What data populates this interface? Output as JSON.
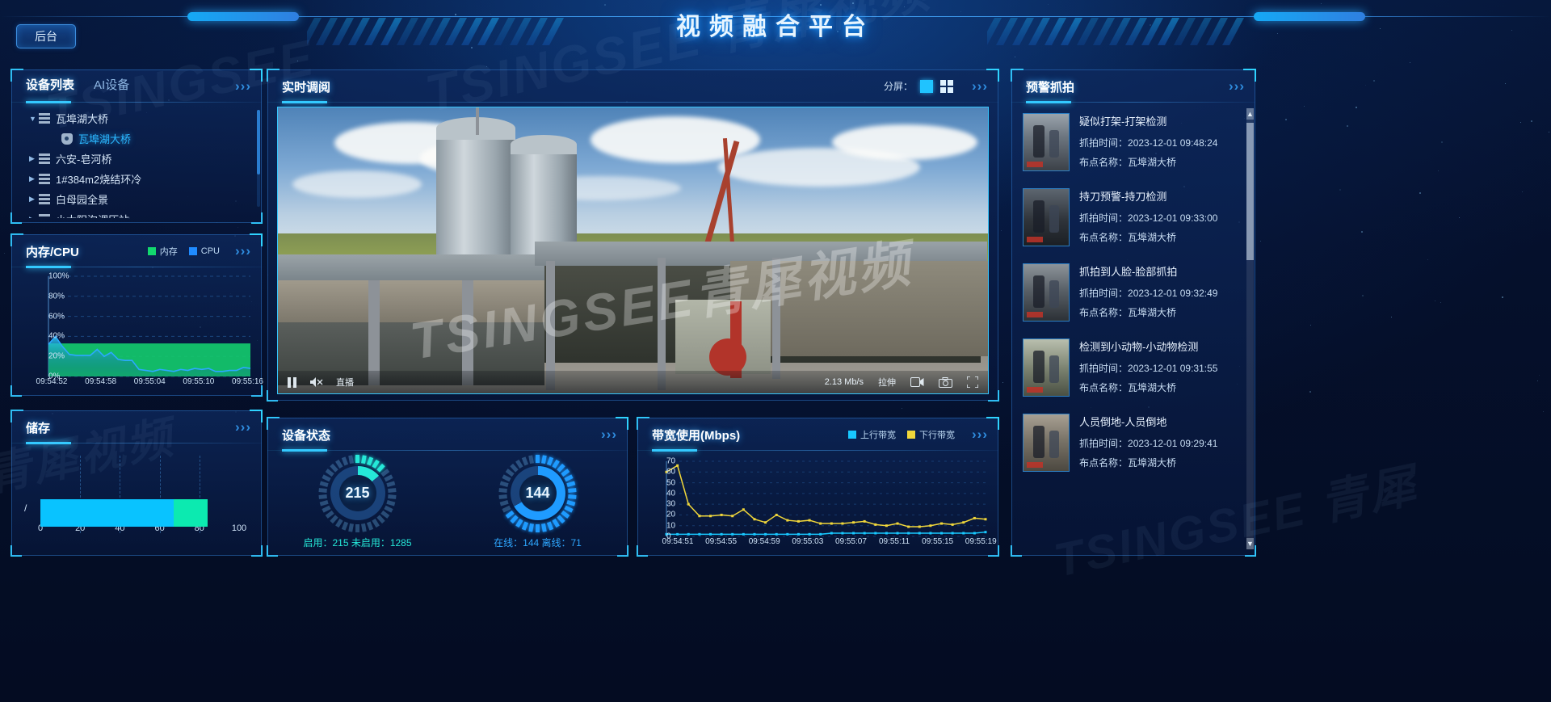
{
  "header": {
    "backstage_label": "后台",
    "title": "视频融合平台"
  },
  "devices_panel": {
    "tabs": [
      {
        "label": "设备列表",
        "active": true
      },
      {
        "label": "AI设备",
        "active": false
      }
    ],
    "more_icon": "chevron-right-triple-icon",
    "tree": [
      {
        "label": "瓦埠湖大桥",
        "icon": "server-icon",
        "expanded": true,
        "level": 0,
        "selected": false
      },
      {
        "label": "瓦埠湖大桥",
        "icon": "camera-icon",
        "expanded": false,
        "level": 1,
        "selected": true
      },
      {
        "label": "六安-皂河桥",
        "icon": "server-icon",
        "expanded": false,
        "level": 0,
        "selected": false
      },
      {
        "label": "1#384m2烧结环冷",
        "icon": "server-icon",
        "expanded": false,
        "level": 0,
        "selected": false
      },
      {
        "label": "白母园全景",
        "icon": "server-icon",
        "expanded": false,
        "level": 0,
        "selected": false
      },
      {
        "label": "小太阳沟调压站",
        "icon": "server-icon",
        "expanded": false,
        "level": 0,
        "selected": false
      }
    ]
  },
  "memory_panel": {
    "title": "内存/CPU",
    "legend": [
      {
        "label": "内存",
        "color": "#12d86e"
      },
      {
        "label": "CPU",
        "color": "#1f8bff"
      }
    ]
  },
  "storage_panel": {
    "title": "储存",
    "root_label": "/",
    "used_percent": 67,
    "secondary_percent": 17,
    "ticks": [
      "0",
      "20",
      "40",
      "60",
      "80",
      "100"
    ],
    "fill_color_a": "#09c3ff",
    "fill_color_b": "#0ceab0"
  },
  "live_panel": {
    "title": "实时调阅",
    "split_label": "分屏：",
    "split_options": [
      {
        "name": "single-split",
        "selected": true
      },
      {
        "name": "quad-split",
        "selected": false
      }
    ],
    "video_controls": {
      "pause_icon": "pause-icon",
      "mute_icon": "speaker-muted-icon",
      "live_label": "直播",
      "bitrate": "2.13 Mb/s",
      "stretch_label": "拉伸",
      "record_icon": "video-record-icon",
      "snapshot_icon": "camera-snapshot-icon",
      "fullscreen_icon": "fullscreen-icon"
    },
    "watermark": "TSINGSEE青犀视频"
  },
  "device_status_panel": {
    "title": "设备状态",
    "gauges": [
      {
        "value": "215",
        "percent": 14,
        "color": "#25e8d8",
        "footer": "启用：215  未启用：1285"
      },
      {
        "value": "144",
        "percent": 67,
        "color": "#1f9bff",
        "footer": "在线：144  离线：71"
      }
    ]
  },
  "bandwidth_panel": {
    "title": "带宽使用(Mbps)",
    "legend": [
      {
        "label": "上行带宽",
        "color": "#18c8ff"
      },
      {
        "label": "下行带宽",
        "color": "#f1d73a"
      }
    ]
  },
  "alerts_panel": {
    "title": "预警抓拍",
    "time_label": "抓拍时间：",
    "site_label": "布点名称：",
    "items": [
      {
        "title": "疑似打架-打架检测",
        "time": "2023-12-01 09:48:24",
        "site": "瓦埠湖大桥"
      },
      {
        "title": "持刀预警-持刀检测",
        "time": "2023-12-01 09:33:00",
        "site": "瓦埠湖大桥"
      },
      {
        "title": "抓拍到人脸-脸部抓拍",
        "time": "2023-12-01 09:32:49",
        "site": "瓦埠湖大桥"
      },
      {
        "title": "检测到小动物-小动物检测",
        "time": "2023-12-01 09:31:55",
        "site": "瓦埠湖大桥"
      },
      {
        "title": "人员倒地-人员倒地",
        "time": "2023-12-01 09:29:41",
        "site": "瓦埠湖大桥"
      }
    ]
  },
  "chart_data": [
    {
      "type": "area",
      "title": "内存/CPU",
      "xlabel": "",
      "ylabel": "",
      "ylim": [
        0,
        100
      ],
      "yticks": [
        "0%",
        "20%",
        "40%",
        "60%",
        "80%",
        "100%"
      ],
      "xticks": [
        "09:54:52",
        "09:54:58",
        "09:55:04",
        "09:55:10",
        "09:55:16"
      ],
      "grid": true,
      "legend_position": "top-right",
      "series": [
        {
          "name": "内存",
          "color": "#12d86e",
          "values": [
            33,
            33,
            33,
            33,
            33,
            33,
            33,
            33,
            33,
            33,
            33,
            33,
            33,
            33,
            33,
            33,
            33,
            33,
            33,
            33,
            33,
            33,
            33,
            33,
            33,
            33,
            33,
            33,
            33,
            33
          ]
        },
        {
          "name": "CPU",
          "color": "#1f8bff",
          "values": [
            32,
            40,
            30,
            22,
            21,
            21,
            21,
            27,
            20,
            24,
            17,
            16,
            16,
            7,
            6,
            5,
            7,
            6,
            5,
            7,
            6,
            8,
            7,
            8,
            5,
            5,
            6,
            6,
            9,
            8
          ]
        }
      ]
    },
    {
      "type": "bar",
      "title": "储存",
      "categories": [
        "/"
      ],
      "values": [
        84
      ],
      "xlabel": "",
      "ylabel": "",
      "xlim": [
        0,
        100
      ],
      "xticks": [
        "0",
        "20",
        "40",
        "60",
        "80",
        "100"
      ]
    },
    {
      "type": "line",
      "title": "带宽使用(Mbps)",
      "xlabel": "",
      "ylabel": "Mbps",
      "ylim": [
        0,
        70
      ],
      "yticks": [
        "0",
        "10",
        "20",
        "30",
        "40",
        "50",
        "60",
        "70"
      ],
      "xticks": [
        "09:54:51",
        "09:54:55",
        "09:54:59",
        "09:55:03",
        "09:55:07",
        "09:55:11",
        "09:55:15",
        "09:55:19"
      ],
      "grid": true,
      "legend_position": "top-right",
      "series": [
        {
          "name": "上行带宽",
          "color": "#18c8ff",
          "values": [
            2,
            2,
            2,
            2,
            2,
            2,
            2,
            2,
            2,
            2,
            2,
            2,
            2,
            2,
            2,
            3,
            3,
            3,
            3,
            3,
            3,
            3,
            3,
            3,
            3,
            3,
            3,
            3,
            3,
            4
          ]
        },
        {
          "name": "下行带宽",
          "color": "#f1d73a",
          "values": [
            60,
            66,
            30,
            19,
            19,
            20,
            19,
            25,
            16,
            13,
            20,
            15,
            14,
            15,
            12,
            12,
            12,
            13,
            14,
            11,
            10,
            12,
            9,
            9,
            10,
            12,
            11,
            13,
            17,
            16
          ]
        }
      ]
    }
  ]
}
